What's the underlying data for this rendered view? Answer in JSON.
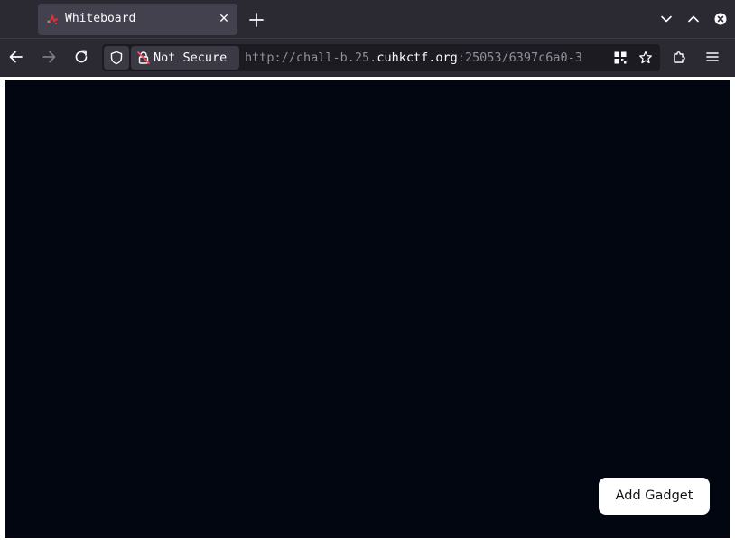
{
  "tab": {
    "title": "Whiteboard",
    "favicon": "whiteboard-favicon-icon",
    "close_symbol": "✕"
  },
  "toolbar": {
    "back_icon": "arrow-left-icon",
    "forward_icon": "arrow-right-icon",
    "reload_icon": "reload-icon"
  },
  "urlbar": {
    "security_label": "Not Secure",
    "url_scheme": "http://chall-b.25.",
    "url_host": "cuhkctf.org",
    "url_rest": ":25053/6397c6a0-3"
  },
  "page": {
    "add_gadget_label": "Add Gadget"
  },
  "colors": {
    "chrome": "#2b2a33",
    "active_tab": "#42414d",
    "urlbar": "#1c1b22",
    "canvas": "#020610",
    "button": "#ffffff"
  }
}
